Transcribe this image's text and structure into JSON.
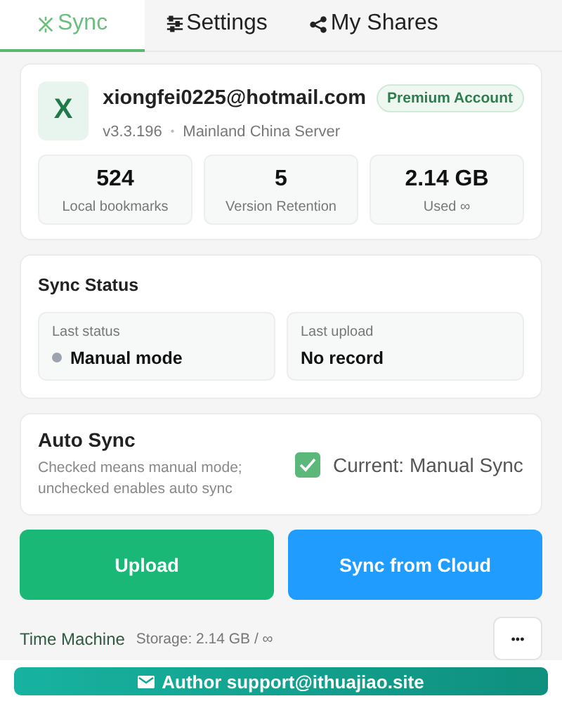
{
  "tabs": [
    {
      "label": "Sync",
      "kind": "sync",
      "selected": true
    },
    {
      "label": "Settings",
      "kind": "settings",
      "selected": false
    },
    {
      "label": "My Shares",
      "kind": "share",
      "selected": false
    }
  ],
  "account": {
    "initial": "X",
    "email": "xiongfei0225@hotmail.com",
    "badge": "Premium Account",
    "version": "v3.3.196",
    "separator": "•",
    "server": "Mainland China Server",
    "stats": [
      {
        "value": "524",
        "label": "Local bookmarks"
      },
      {
        "value": "5",
        "label": "Version Retention"
      },
      {
        "value": "2.14 GB",
        "label": "Used ∞"
      }
    ]
  },
  "sync_status": {
    "title": "Sync Status",
    "items": [
      {
        "label": "Last status",
        "value": "Manual mode",
        "color": "#9ca3af"
      },
      {
        "label": "Last upload",
        "value": "No record"
      }
    ]
  },
  "auto_sync": {
    "title": "Auto Sync",
    "description": "Checked means manual mode; unchecked enables auto sync",
    "checked": true,
    "label": "Current: Manual Sync"
  },
  "actions": [
    {
      "label": "Upload",
      "kind": "upload"
    },
    {
      "label": "Sync from Cloud",
      "kind": "cloud"
    }
  ],
  "time_machine": {
    "title": "Time Machine",
    "storage": "Storage: 2.14 GB / ∞",
    "more": "•••"
  },
  "footer": {
    "label": "Author support@ithuajiao.site"
  }
}
